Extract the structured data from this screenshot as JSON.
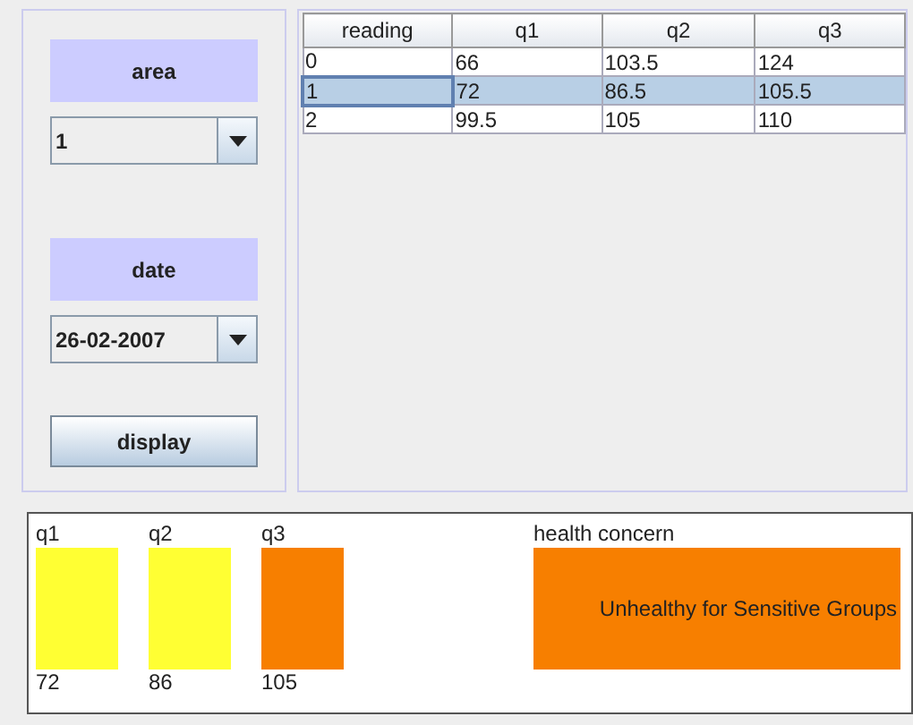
{
  "controls": {
    "area_label": "area",
    "area_value": "1",
    "date_label": "date",
    "date_value": "26-02-2007",
    "display_button": "display"
  },
  "table": {
    "columns": [
      "reading",
      "q1",
      "q2",
      "q3"
    ],
    "rows": [
      {
        "cells": [
          "0",
          "66",
          "103.5",
          "124"
        ],
        "selected": false
      },
      {
        "cells": [
          "1",
          "72",
          "86.5",
          "105.5"
        ],
        "selected": true
      },
      {
        "cells": [
          "2",
          "99.5",
          "105",
          "110"
        ],
        "selected": false
      }
    ]
  },
  "indicators": [
    {
      "label": "q1",
      "value": "72",
      "color": "#ffff33"
    },
    {
      "label": "q2",
      "value": "86",
      "color": "#ffff33"
    },
    {
      "label": "q3",
      "value": "105",
      "color": "#f77f00"
    }
  ],
  "health_concern": {
    "label": "health concern",
    "text": "Unhealthy for Sensitive Groups",
    "color": "#f77f00"
  }
}
